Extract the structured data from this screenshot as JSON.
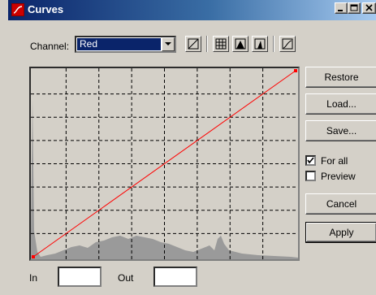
{
  "window": {
    "title": "Curves"
  },
  "channel": {
    "label": "Channel:",
    "selected": "Red"
  },
  "toolbar": {
    "icons": [
      "curve-mode-icon",
      "grid-icon",
      "dark-tone-icon",
      "light-tone-icon",
      "smooth-curve-icon"
    ]
  },
  "curve_graph": {
    "curve_color": "#ff0000",
    "grid_lines": 8,
    "points": [
      {
        "in": 0,
        "out": 0
      },
      {
        "in": 255,
        "out": 255
      }
    ]
  },
  "buttons": {
    "restore": "Restore",
    "load": "Load...",
    "save": "Save...",
    "cancel": "Cancel",
    "apply": "Apply"
  },
  "options": {
    "for_all": {
      "label": "For all",
      "checked": true
    },
    "preview": {
      "label": "Preview",
      "checked": false
    }
  },
  "inputs": {
    "in_label": "In",
    "in_value": "",
    "out_label": "Out",
    "out_value": ""
  }
}
